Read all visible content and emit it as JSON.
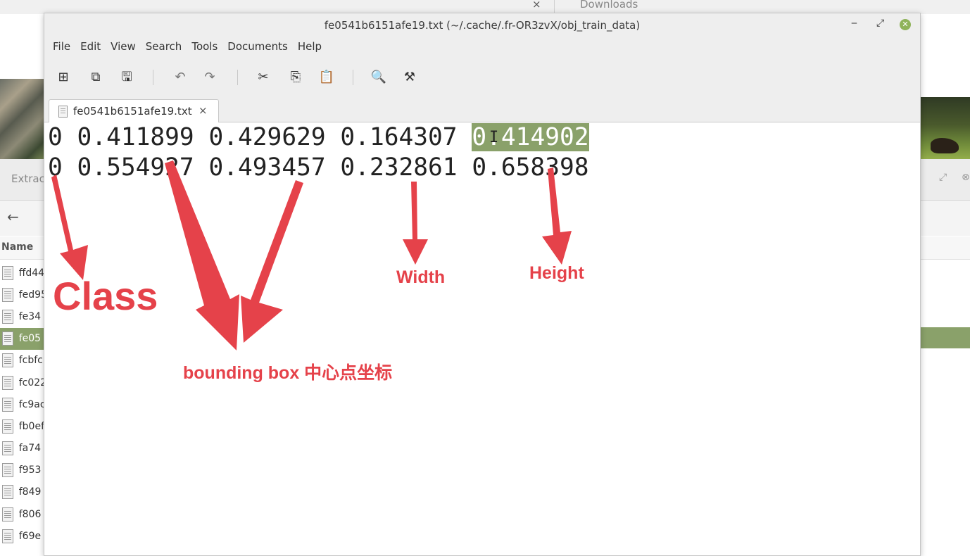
{
  "background": {
    "tab_close": "×",
    "tab_title": "Downloads",
    "extract_label": "Extrac",
    "column_name": "Name",
    "files": [
      "ffd44",
      "fed95",
      "fe34",
      "fe05",
      "fcbfc",
      "fc022",
      "fc9ac",
      "fb0ef",
      "fa74",
      "f953",
      "f849",
      "f806",
      "f69e"
    ],
    "selected_index": 3
  },
  "window": {
    "title": "fe0541b6151afe19.txt (~/.cache/.fr-OR3zvX/obj_train_data)",
    "minimize_glyph": "‒",
    "maximize_glyph": "⤢",
    "close_glyph": "✕"
  },
  "menu": [
    "File",
    "Edit",
    "View",
    "Search",
    "Tools",
    "Documents",
    "Help"
  ],
  "toolbar": {
    "new_icon": "⊞",
    "open_icon": "⧉",
    "save_icon": "🖫",
    "undo_icon": "↶",
    "redo_icon": "↷",
    "cut_icon": "✂",
    "copy_icon": "⎘",
    "paste_icon": "📋",
    "find_icon": "🔍",
    "replace_icon": "⚒"
  },
  "tab": {
    "label": "fe0541b6151afe19.txt",
    "close": "×"
  },
  "editor": {
    "lines": [
      {
        "text": "0 0.411899 0.429629 0.164307 ",
        "highlight": "0.414902"
      },
      {
        "text": "0 0.554927 0.493457 0.232861 0.658398",
        "highlight": ""
      }
    ],
    "cursor_glyph": "I"
  },
  "annotations": {
    "class": "Class",
    "bbox_center": "bounding box 中心点坐标",
    "width": "Width",
    "height": "Height",
    "color": "#e5424a"
  },
  "colors": {
    "selection": "#8aa16a",
    "chrome": "#eeeeee"
  }
}
